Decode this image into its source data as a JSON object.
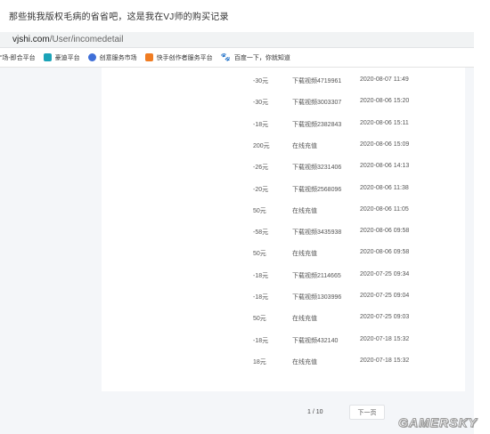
{
  "caption": "那些挑我版权毛病的省省吧，这是我在VJ师的购买记录",
  "url": {
    "host": "vjshi.com",
    "path": "/User/incomedetail"
  },
  "bookmarks": [
    {
      "label": "“场-即合平台",
      "icon": "none"
    },
    {
      "label": "豪迪平台",
      "icon": "teal-square"
    },
    {
      "label": "创意服务市场",
      "icon": "blue-circle"
    },
    {
      "label": "快手创作者服务平台",
      "icon": "orange-square"
    },
    {
      "label": "百度一下，你就知道",
      "icon": "paw"
    }
  ],
  "records": [
    {
      "amount": "-30元",
      "desc": "下载视频4719961",
      "date": "2020-08-07 11:49"
    },
    {
      "amount": "-30元",
      "desc": "下载视频3003307",
      "date": "2020-08-06 15:20"
    },
    {
      "amount": "-18元",
      "desc": "下载视频2382843",
      "date": "2020-08-06 15:11"
    },
    {
      "amount": "200元",
      "desc": "在线充值",
      "date": "2020-08-06 15:09"
    },
    {
      "amount": "-26元",
      "desc": "下载视频3231406",
      "date": "2020-08-06 14:13"
    },
    {
      "amount": "-20元",
      "desc": "下载视频2568096",
      "date": "2020-08-06 11:38"
    },
    {
      "amount": "50元",
      "desc": "在线充值",
      "date": "2020-08-06 11:05"
    },
    {
      "amount": "-58元",
      "desc": "下载视频3435938",
      "date": "2020-08-06 09:58"
    },
    {
      "amount": "50元",
      "desc": "在线充值",
      "date": "2020-08-06 09:58"
    },
    {
      "amount": "-18元",
      "desc": "下载视频2114665",
      "date": "2020-07-25 09:34"
    },
    {
      "amount": "-18元",
      "desc": "下载视频1303996",
      "date": "2020-07-25 09:04"
    },
    {
      "amount": "50元",
      "desc": "在线充值",
      "date": "2020-07-25 09:03"
    },
    {
      "amount": "-18元",
      "desc": "下载视频432140",
      "date": "2020-07-18 15:32"
    },
    {
      "amount": "18元",
      "desc": "在线充值",
      "date": "2020-07-18 15:32"
    }
  ],
  "pagination": {
    "info": "1 / 10",
    "next_label": "下一页"
  },
  "watermark": "GAMERSKY"
}
